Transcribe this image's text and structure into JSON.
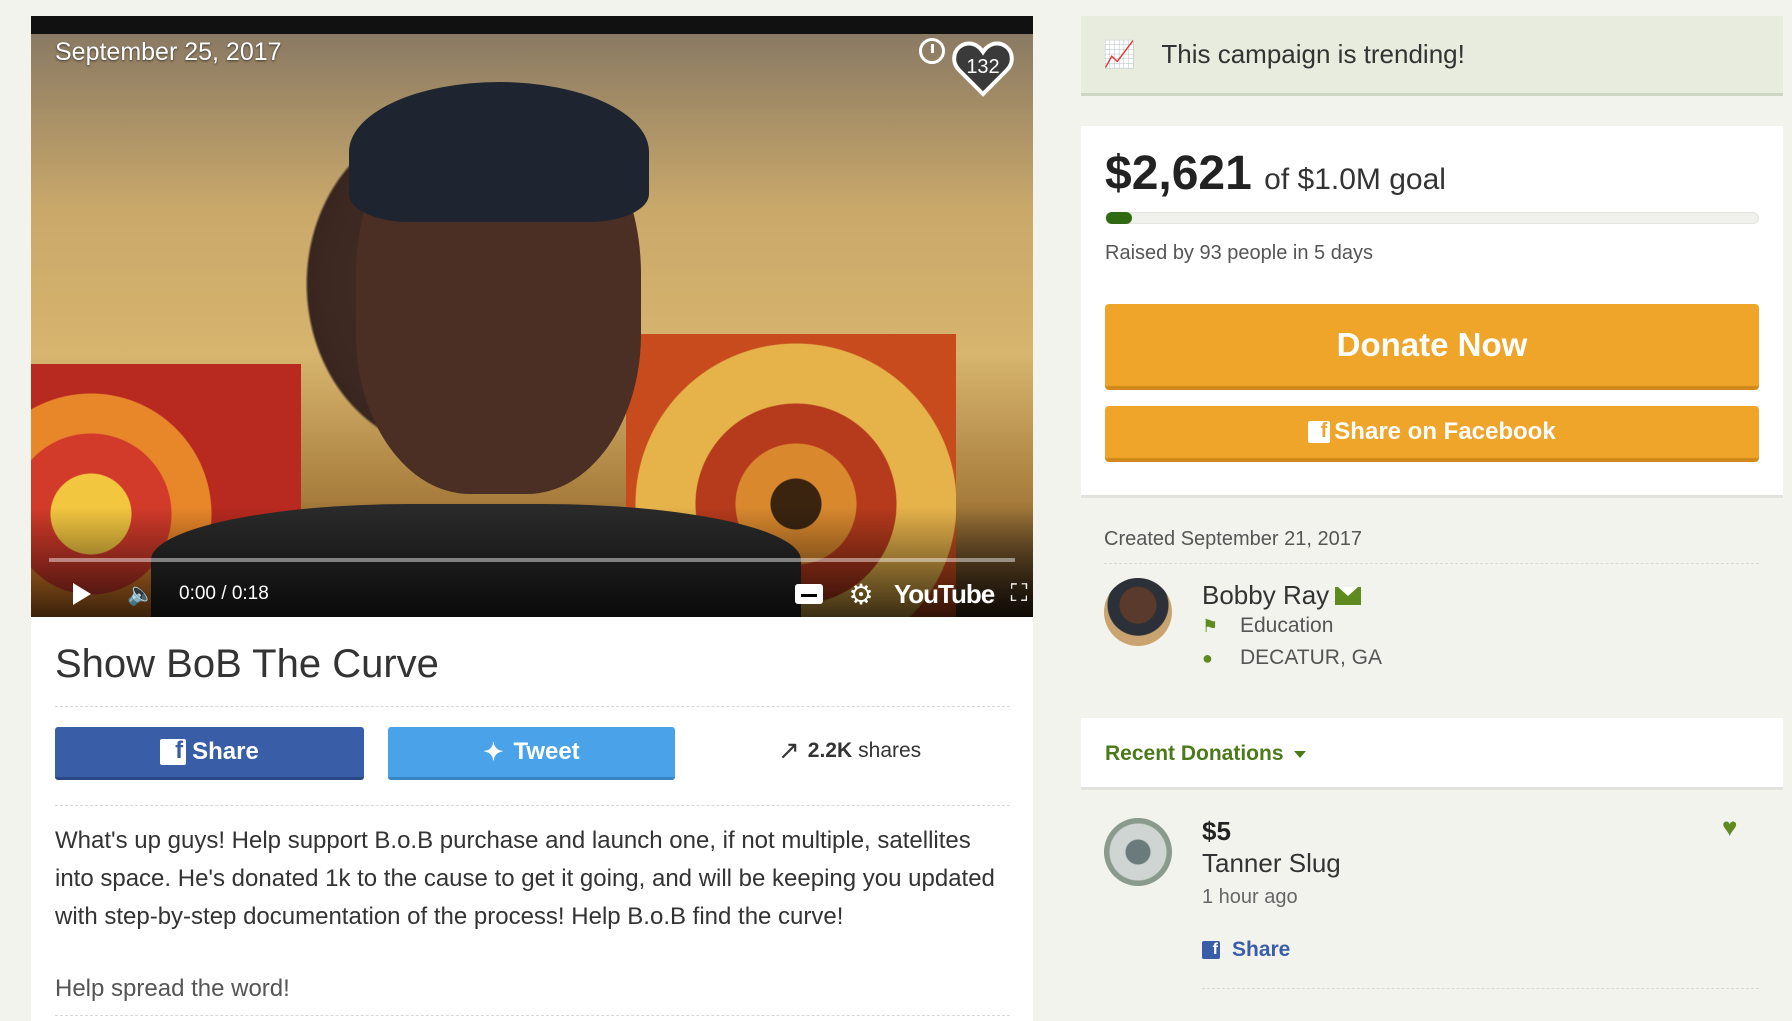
{
  "video": {
    "date": "September 25, 2017",
    "heart_count": "132",
    "time": "0:00 / 0:18",
    "youtube_label": "YouTube"
  },
  "campaign": {
    "title": "Show BoB The Curve",
    "share_label": "Share",
    "tweet_label": "Tweet",
    "shares_count": "2.2K",
    "shares_label": "shares",
    "story": "What's up guys! Help support B.o.B purchase and launch one, if not multiple, satellites into space. He's donated 1k to the cause to get it going, and will be keeping you updated with step-by-step documentation of the process! Help B.o.B find the curve!",
    "spread": "Help spread the word!"
  },
  "sidebar": {
    "trending_text": "This campaign is trending!",
    "raised_amount": "$2,621",
    "goal_text": "of $1.0M goal",
    "progress_fraction": 0.0026,
    "raised_by": "Raised by 93 people in 5 days",
    "donate_label": "Donate Now",
    "share_facebook_label": "Share on Facebook",
    "created": "Created September 21, 2017",
    "organizer_name": "Bobby Ray",
    "category": "Education",
    "location": "DECATUR, GA",
    "recent_label": "Recent Donations",
    "donations": [
      {
        "amount": "$5",
        "name": "Tanner Slug",
        "time": "1 hour ago",
        "share_label": "Share"
      }
    ]
  },
  "colors": {
    "accent_green": "#5e8a1f",
    "donate_orange": "#efa42a",
    "facebook_blue": "#3a5da8",
    "twitter_blue": "#4aa3e8"
  },
  "icons": [
    "play-icon",
    "volume-icon",
    "captions-icon",
    "gear-icon",
    "fullscreen-icon",
    "heart-icon",
    "clock-icon",
    "facebook-icon",
    "twitter-icon",
    "trending-icon",
    "tag-icon",
    "location-pin-icon",
    "mail-icon",
    "caret-down-icon"
  ]
}
